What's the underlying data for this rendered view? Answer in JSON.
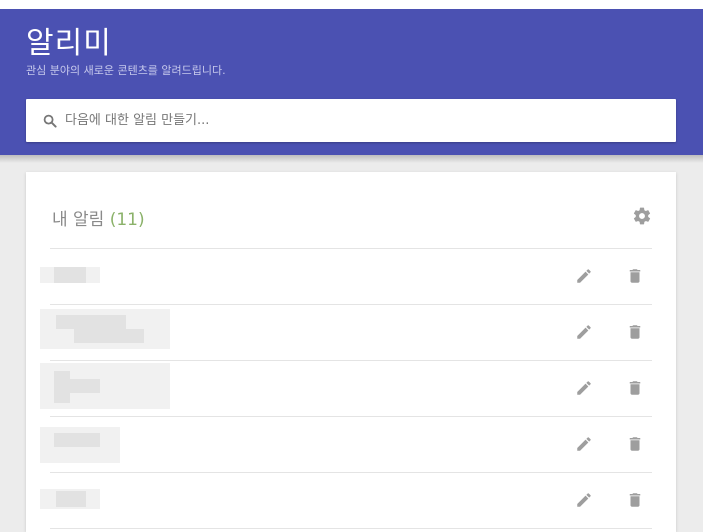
{
  "header": {
    "title": "알리미",
    "subtitle": "관심 분야의 새로운 콘텐츠를 알려드립니다."
  },
  "search": {
    "placeholder": "다음에 대한 알림 만들기..."
  },
  "alerts_card": {
    "title": "내 알림",
    "count": "(11)",
    "items": [
      {
        "name": ""
      },
      {
        "name": ""
      },
      {
        "name": ""
      },
      {
        "name": ""
      },
      {
        "name": ""
      }
    ]
  },
  "colors": {
    "header_bg": "#4b51b2",
    "count_green": "#8bb26a",
    "icon_gray": "#9e9e9e"
  },
  "icons": {
    "search": "search-icon",
    "settings": "gear-icon",
    "edit": "pencil-icon",
    "delete": "trash-icon"
  }
}
